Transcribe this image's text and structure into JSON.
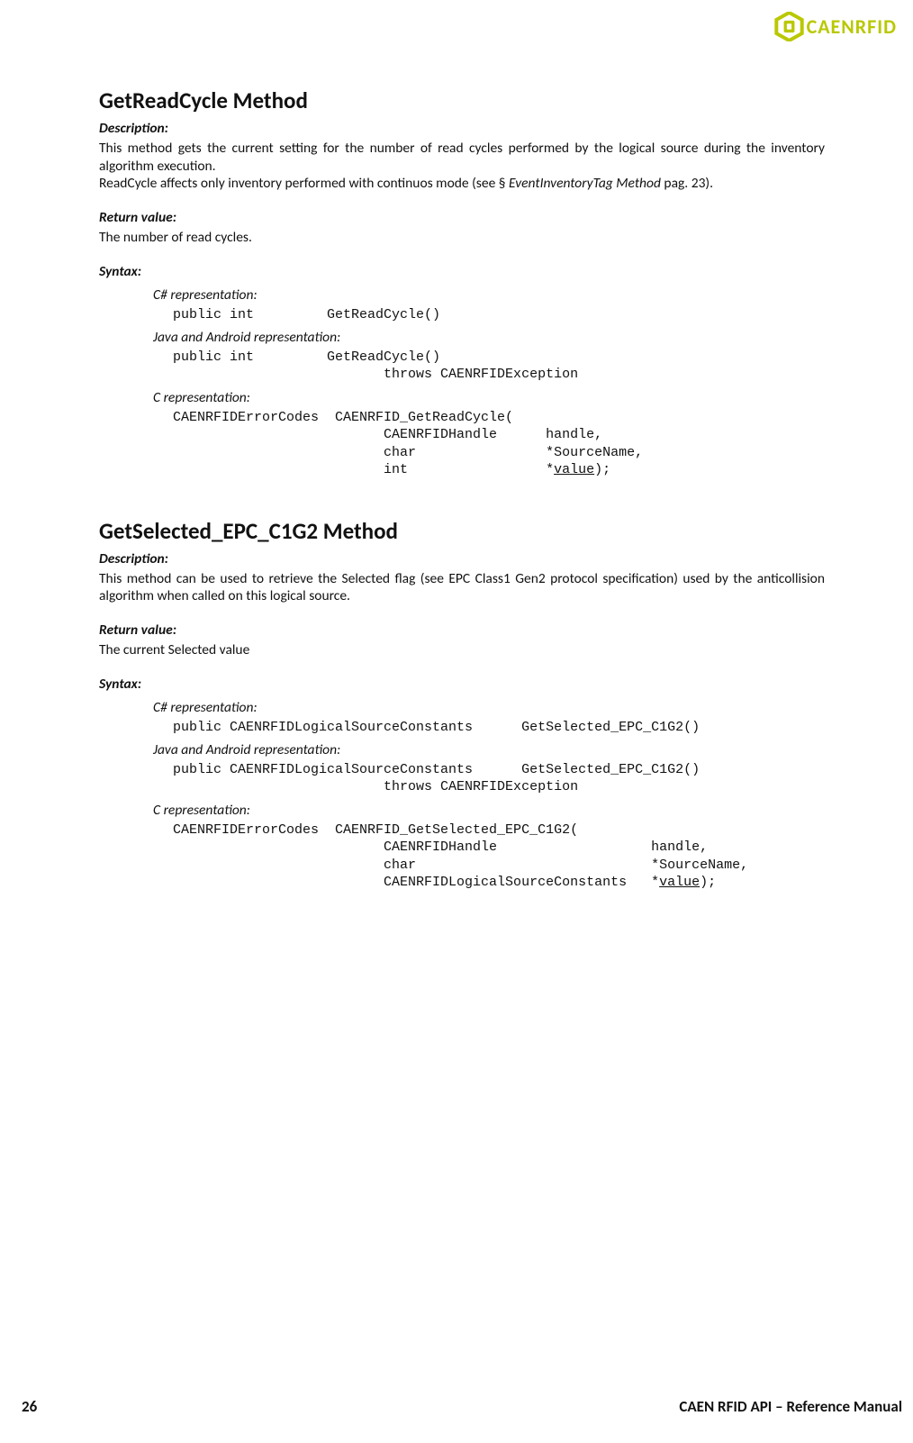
{
  "brand": "CAENRFID",
  "sections": [
    {
      "title": "GetReadCycle Method",
      "desc_label": "Description:",
      "desc_html": "This method gets the current setting for the number of read cycles performed by the logical source during the inventory algorithm execution.\nReadCycle affects only inventory performed with continuos mode (see § <i>EventInventoryTag Method</i> pag. 23).",
      "ret_label": "Return value:",
      "ret_text": "The number of read cycles.",
      "syntax_label": "Syntax:",
      "reps": [
        {
          "label": "C# representation:",
          "code_html": "public int         GetReadCycle()"
        },
        {
          "label": "Java and Android representation:",
          "code_html": "public int         GetReadCycle()\n                          throws CAENRFIDException"
        },
        {
          "label": "C representation:",
          "code_html": "CAENRFIDErrorCodes  CAENRFID_GetReadCycle(\n                          CAENRFIDHandle      handle,\n                          char                *SourceName,\n                          int                 *<span class=\"u\">value</span>);"
        }
      ]
    },
    {
      "title": "GetSelected_EPC_C1G2 Method",
      "desc_label": "Description:",
      "desc_html": "This method can be used to retrieve the Selected flag (see EPC Class1 Gen2 protocol specification) used by the anticollision algorithm when called on this logical source.",
      "ret_label": "Return value:",
      "ret_text": "The current Selected value",
      "syntax_label": "Syntax:",
      "reps": [
        {
          "label": "C# representation:",
          "code_html": "public CAENRFIDLogicalSourceConstants      GetSelected_EPC_C1G2()"
        },
        {
          "label": "Java and Android representation:",
          "code_html": "public CAENRFIDLogicalSourceConstants      GetSelected_EPC_C1G2()\n                          throws CAENRFIDException"
        },
        {
          "label": "C representation:",
          "code_html": "CAENRFIDErrorCodes  CAENRFID_GetSelected_EPC_C1G2(\n                          CAENRFIDHandle                   handle,\n                          char                             *SourceName,\n                          CAENRFIDLogicalSourceConstants   *<span class=\"u\">value</span>);"
        }
      ]
    }
  ],
  "footer": {
    "page": "26",
    "title": "CAEN RFID API – Reference Manual"
  }
}
